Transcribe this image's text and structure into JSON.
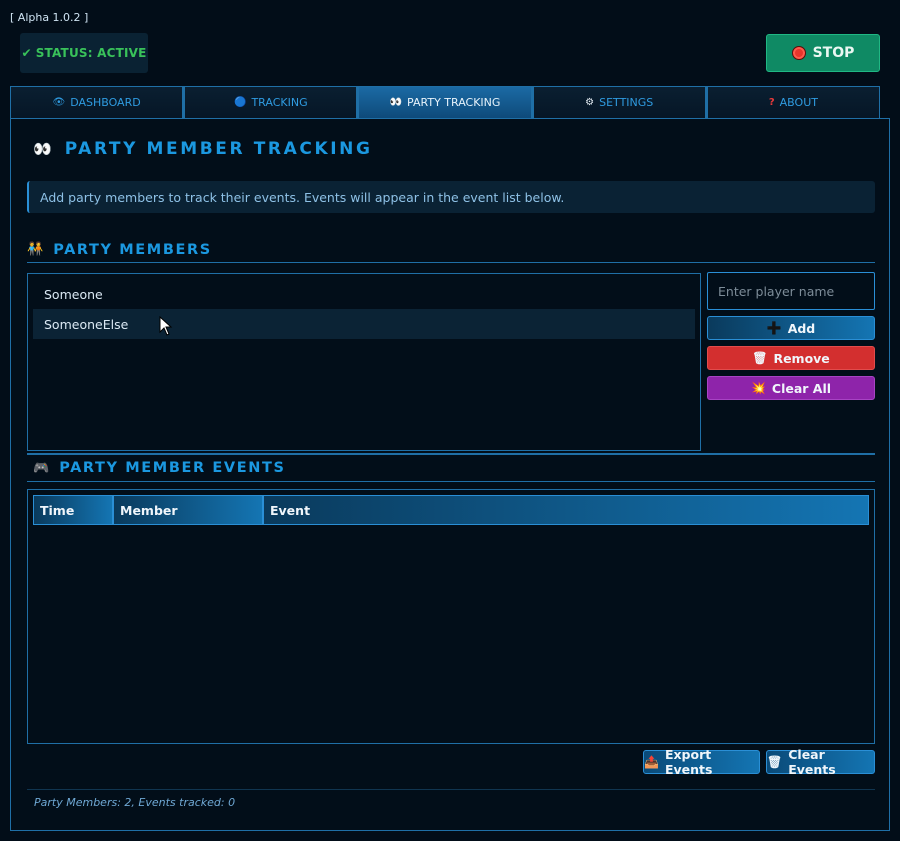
{
  "app": {
    "version": "[ Alpha 1.0.2 ]"
  },
  "status": {
    "check": "✔",
    "label": "STATUS: ACTIVE",
    "color": "#39c25a"
  },
  "stop_button": {
    "label": "STOP"
  },
  "tabs": [
    {
      "icon": "👁",
      "label": "DASHBOARD"
    },
    {
      "icon": "🔵",
      "label": "TRACKING"
    },
    {
      "icon": "👀",
      "label": "PARTY TRACKING",
      "active": true
    },
    {
      "icon": "⚙",
      "label": "SETTINGS"
    },
    {
      "icon": "?",
      "label": "ABOUT"
    }
  ],
  "page": {
    "icon": "👀",
    "title": "PARTY MEMBER TRACKING",
    "info": "Add party members to track their events. Events will appear in the event list below."
  },
  "members_section": {
    "icon": "🧑‍🤝‍🧑",
    "title": "PARTY MEMBERS",
    "members": [
      "Someone",
      "SomeoneElse"
    ],
    "input_placeholder": "Enter player name",
    "add_icon": "➕",
    "add_label": "Add",
    "remove_icon": "🗑",
    "remove_label": "Remove",
    "clear_all_icon": "💥",
    "clear_all_label": "Clear All"
  },
  "events_section": {
    "icon": "🎮",
    "title": "PARTY MEMBER EVENTS",
    "columns": [
      "Time",
      "Member",
      "Event"
    ],
    "rows": [],
    "export_icon": "📤",
    "export_label": "Export Events",
    "clear_icon": "🗑",
    "clear_label": "Clear Events"
  },
  "footer": {
    "text": "Party Members: 2, Events tracked: 0"
  },
  "colors": {
    "accent": "#1b98e0",
    "border": "#1f6fa6",
    "background": "#020d18",
    "stop": "#0f8a64",
    "remove": "#d32f2f",
    "clear_all": "#8e24aa"
  }
}
